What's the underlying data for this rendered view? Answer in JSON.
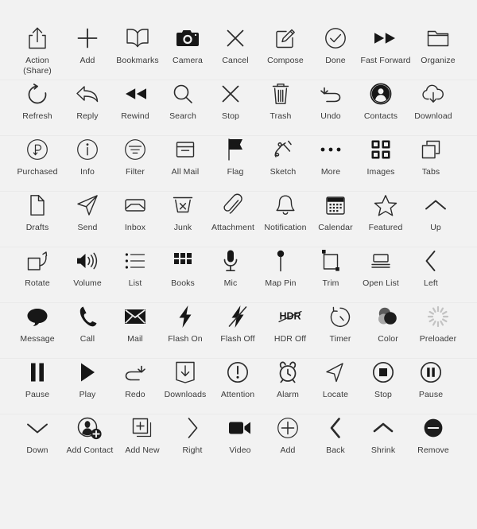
{
  "page": {
    "title": "iOS Icon Set Sheet",
    "background_color": "#f2f2f2",
    "icon_color": "#2b2b2b",
    "label_color": "#3a3a3a",
    "columns": 9,
    "rows": 8,
    "total_icons": 72
  },
  "rows": [
    {
      "index": 1,
      "icons": [
        {
          "name": "action-share",
          "label": "Action\n(Share)",
          "label_line1": "Action",
          "label_line2": "(Share)",
          "icon": "share-box-arrow-up-icon"
        },
        {
          "name": "add",
          "label": "Add",
          "icon": "plus-icon"
        },
        {
          "name": "bookmarks",
          "label": "Bookmarks",
          "icon": "open-book-icon"
        },
        {
          "name": "camera",
          "label": "Camera",
          "icon": "camera-icon"
        },
        {
          "name": "cancel",
          "label": "Cancel",
          "icon": "x-cross-icon"
        },
        {
          "name": "compose",
          "label": "Compose",
          "icon": "pencil-square-icon"
        },
        {
          "name": "done",
          "label": "Done",
          "icon": "check-circle-icon"
        },
        {
          "name": "fast-forward",
          "label": "Fast Forward",
          "icon": "double-triangle-right-icon"
        },
        {
          "name": "organize",
          "label": "Organize",
          "icon": "folder-icon"
        }
      ]
    },
    {
      "index": 2,
      "icons": [
        {
          "name": "refresh",
          "label": "Refresh",
          "icon": "circular-arrow-icon"
        },
        {
          "name": "reply",
          "label": "Reply",
          "icon": "reply-arrow-icon"
        },
        {
          "name": "rewind",
          "label": "Rewind",
          "icon": "double-triangle-left-icon"
        },
        {
          "name": "search",
          "label": "Search",
          "icon": "magnifier-icon"
        },
        {
          "name": "stop",
          "label": "Stop",
          "icon": "x-cross-icon"
        },
        {
          "name": "trash",
          "label": "Trash",
          "icon": "trash-can-icon"
        },
        {
          "name": "undo",
          "label": "Undo",
          "icon": "undo-arrow-icon"
        },
        {
          "name": "contacts",
          "label": "Contacts",
          "icon": "person-circle-filled-icon"
        },
        {
          "name": "download",
          "label": "Download",
          "icon": "cloud-download-icon"
        }
      ]
    },
    {
      "index": 3,
      "icons": [
        {
          "name": "purchased",
          "label": "Purchased",
          "icon": "p-arrow-circle-icon"
        },
        {
          "name": "info",
          "label": "Info",
          "icon": "info-circle-icon"
        },
        {
          "name": "filter",
          "label": "Filter",
          "icon": "filter-circle-icon"
        },
        {
          "name": "all-mail",
          "label": "All Mail",
          "icon": "archive-box-icon"
        },
        {
          "name": "flag",
          "label": "Flag",
          "icon": "flag-icon"
        },
        {
          "name": "sketch",
          "label": "Sketch",
          "icon": "squiggle-icon"
        },
        {
          "name": "more",
          "label": "More",
          "icon": "ellipsis-icon"
        },
        {
          "name": "images",
          "label": "Images",
          "icon": "four-squares-icon"
        },
        {
          "name": "tabs",
          "label": "Tabs",
          "icon": "two-overlapping-squares-icon"
        }
      ]
    },
    {
      "index": 4,
      "icons": [
        {
          "name": "drafts",
          "label": "Drafts",
          "icon": "page-dogear-icon"
        },
        {
          "name": "send",
          "label": "Send",
          "icon": "paper-plane-icon"
        },
        {
          "name": "inbox",
          "label": "Inbox",
          "icon": "inbox-tray-icon"
        },
        {
          "name": "junk",
          "label": "Junk",
          "icon": "junk-box-x-icon"
        },
        {
          "name": "attachment",
          "label": "Attachment",
          "icon": "paperclip-icon"
        },
        {
          "name": "notification",
          "label": "Notification",
          "icon": "bell-icon"
        },
        {
          "name": "calendar",
          "label": "Calendar",
          "icon": "calendar-icon"
        },
        {
          "name": "featured",
          "label": "Featured",
          "icon": "star-outline-icon"
        },
        {
          "name": "up",
          "label": "Up",
          "icon": "chevron-up-icon"
        }
      ]
    },
    {
      "index": 5,
      "icons": [
        {
          "name": "rotate",
          "label": "Rotate",
          "icon": "square-rotate-arrow-icon"
        },
        {
          "name": "volume",
          "label": "Volume",
          "icon": "speaker-waves-icon"
        },
        {
          "name": "list",
          "label": "List",
          "icon": "bulleted-list-icon"
        },
        {
          "name": "books",
          "label": "Books",
          "icon": "grid-nine-icon"
        },
        {
          "name": "mic",
          "label": "Mic",
          "icon": "microphone-icon"
        },
        {
          "name": "map-pin",
          "label": "Map Pin",
          "icon": "map-pin-icon"
        },
        {
          "name": "trim",
          "label": "Trim",
          "icon": "crop-trim-icon"
        },
        {
          "name": "open-list",
          "label": "Open List",
          "icon": "open-list-icon"
        },
        {
          "name": "left",
          "label": "Left",
          "icon": "chevron-left-icon"
        }
      ]
    },
    {
      "index": 6,
      "icons": [
        {
          "name": "message",
          "label": "Message",
          "icon": "speech-bubble-filled-icon"
        },
        {
          "name": "call",
          "label": "Call",
          "icon": "phone-handset-icon"
        },
        {
          "name": "mail",
          "label": "Mail",
          "icon": "envelope-filled-icon"
        },
        {
          "name": "flash-on",
          "label": "Flash On",
          "icon": "lightning-bolt-icon"
        },
        {
          "name": "flash-off",
          "label": "Flash Off",
          "icon": "lightning-bolt-slash-icon"
        },
        {
          "name": "hdr-off",
          "label": "HDR Off",
          "icon": "hdr-slash-icon",
          "glyph_text": "HDR"
        },
        {
          "name": "timer",
          "label": "Timer",
          "icon": "stopwatch-circle-icon"
        },
        {
          "name": "color",
          "label": "Color",
          "icon": "three-overlapping-circles-icon"
        },
        {
          "name": "preloader",
          "label": "Preloader",
          "icon": "spinner-icon"
        }
      ]
    },
    {
      "index": 7,
      "icons": [
        {
          "name": "pause",
          "label": "Pause",
          "icon": "two-bars-icon"
        },
        {
          "name": "play",
          "label": "Play",
          "icon": "triangle-right-icon"
        },
        {
          "name": "redo",
          "label": "Redo",
          "icon": "redo-arrow-icon"
        },
        {
          "name": "downloads",
          "label": "Downloads",
          "icon": "box-arrow-down-icon"
        },
        {
          "name": "attention",
          "label": "Attention",
          "icon": "exclamation-circle-icon"
        },
        {
          "name": "alarm",
          "label": "Alarm",
          "icon": "alarm-clock-icon"
        },
        {
          "name": "locate",
          "label": "Locate",
          "icon": "navigation-arrow-icon"
        },
        {
          "name": "stop-circle",
          "label": "Stop",
          "icon": "stop-square-circle-icon"
        },
        {
          "name": "pause-circle",
          "label": "Pause",
          "icon": "pause-circle-icon"
        }
      ]
    },
    {
      "index": 8,
      "icons": [
        {
          "name": "down",
          "label": "Down",
          "icon": "chevron-down-icon"
        },
        {
          "name": "add-contact",
          "label": "Add Contact",
          "icon": "person-plus-icon"
        },
        {
          "name": "add-new",
          "label": "Add New",
          "icon": "copy-plus-icon"
        },
        {
          "name": "right",
          "label": "Right",
          "icon": "chevron-right-icon"
        },
        {
          "name": "video",
          "label": "Video",
          "icon": "video-camera-icon"
        },
        {
          "name": "add-circle",
          "label": "Add",
          "icon": "plus-circle-icon"
        },
        {
          "name": "back",
          "label": "Back",
          "icon": "chevron-left-bold-icon"
        },
        {
          "name": "shrink",
          "label": "Shrink",
          "icon": "chevron-up-bold-icon"
        },
        {
          "name": "remove",
          "label": "Remove",
          "icon": "minus-circle-filled-icon"
        }
      ]
    }
  ]
}
